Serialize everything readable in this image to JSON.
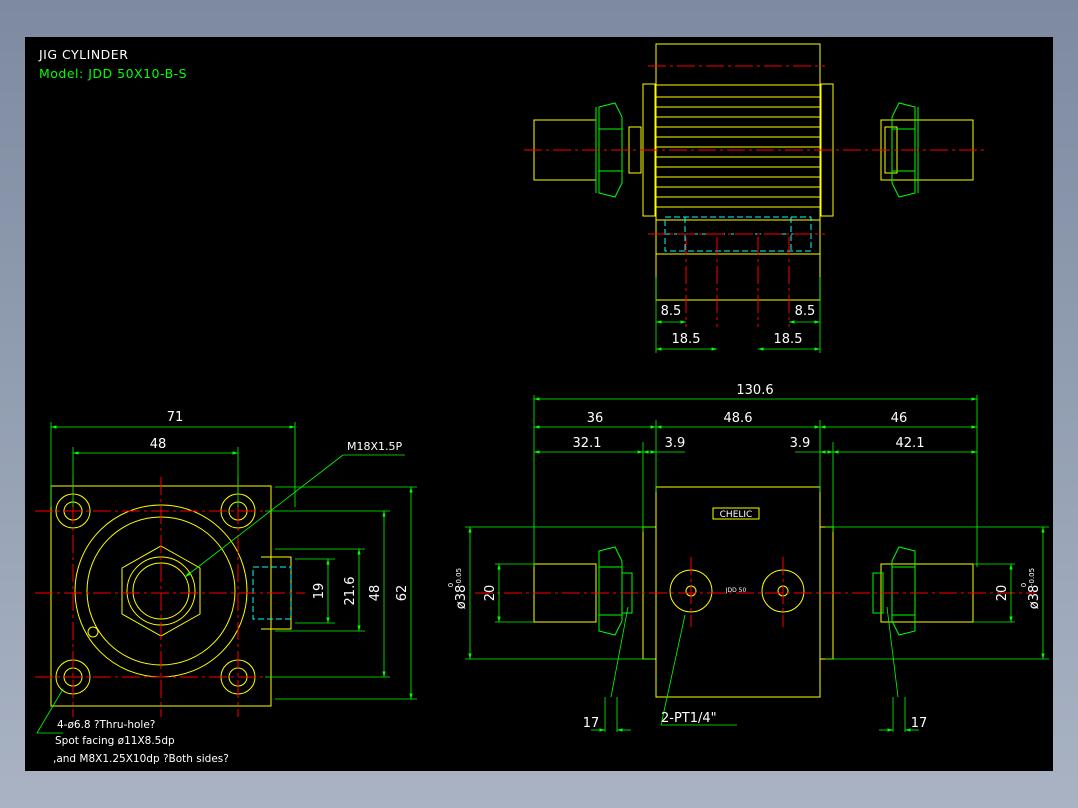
{
  "drawing": {
    "title": "JIG CYLINDER",
    "model": "Model:  JDD  50X10-B-S",
    "colors": {
      "background": "#000000",
      "outline": "#ffff00",
      "dimension": "#00ff00",
      "centerline": "#ff0000",
      "hidden": "#00ffff",
      "text": "#ffffff"
    }
  },
  "dims": {
    "top_left_85": "8.5",
    "top_right_85": "8.5",
    "top_left_185": "18.5",
    "top_right_185": "18.5",
    "overall": "130.6",
    "left_36": "36",
    "mid_486": "48.6",
    "right_46": "46",
    "left_321": "32.1",
    "left_39": "3.9",
    "right_39": "3.9",
    "right_421": "42.1",
    "width_71": "71",
    "pitch_48": "48",
    "port_19": "19",
    "port_216": "21.6",
    "pitch_48v": "48",
    "height_62": "62",
    "rod_20_left": "20",
    "rod_20_right": "20",
    "bore_left": "ø38",
    "bore_right": "ø38",
    "tol_upper": "0",
    "tol_lower": "-0.05",
    "nut_17_left": "17",
    "nut_17_right": "17"
  },
  "notes": {
    "thread": "M18X1.5P",
    "ports": "2-PT1/4\"",
    "holes": "4-ø6.8    ?Thru-hole?",
    "spot": "Spot  facing  ø11X8.5dp",
    "tap": ",and M8X1.25X10dp ?Both  sides?",
    "brand": "CHELIC",
    "plate_model": "JDD 50"
  }
}
